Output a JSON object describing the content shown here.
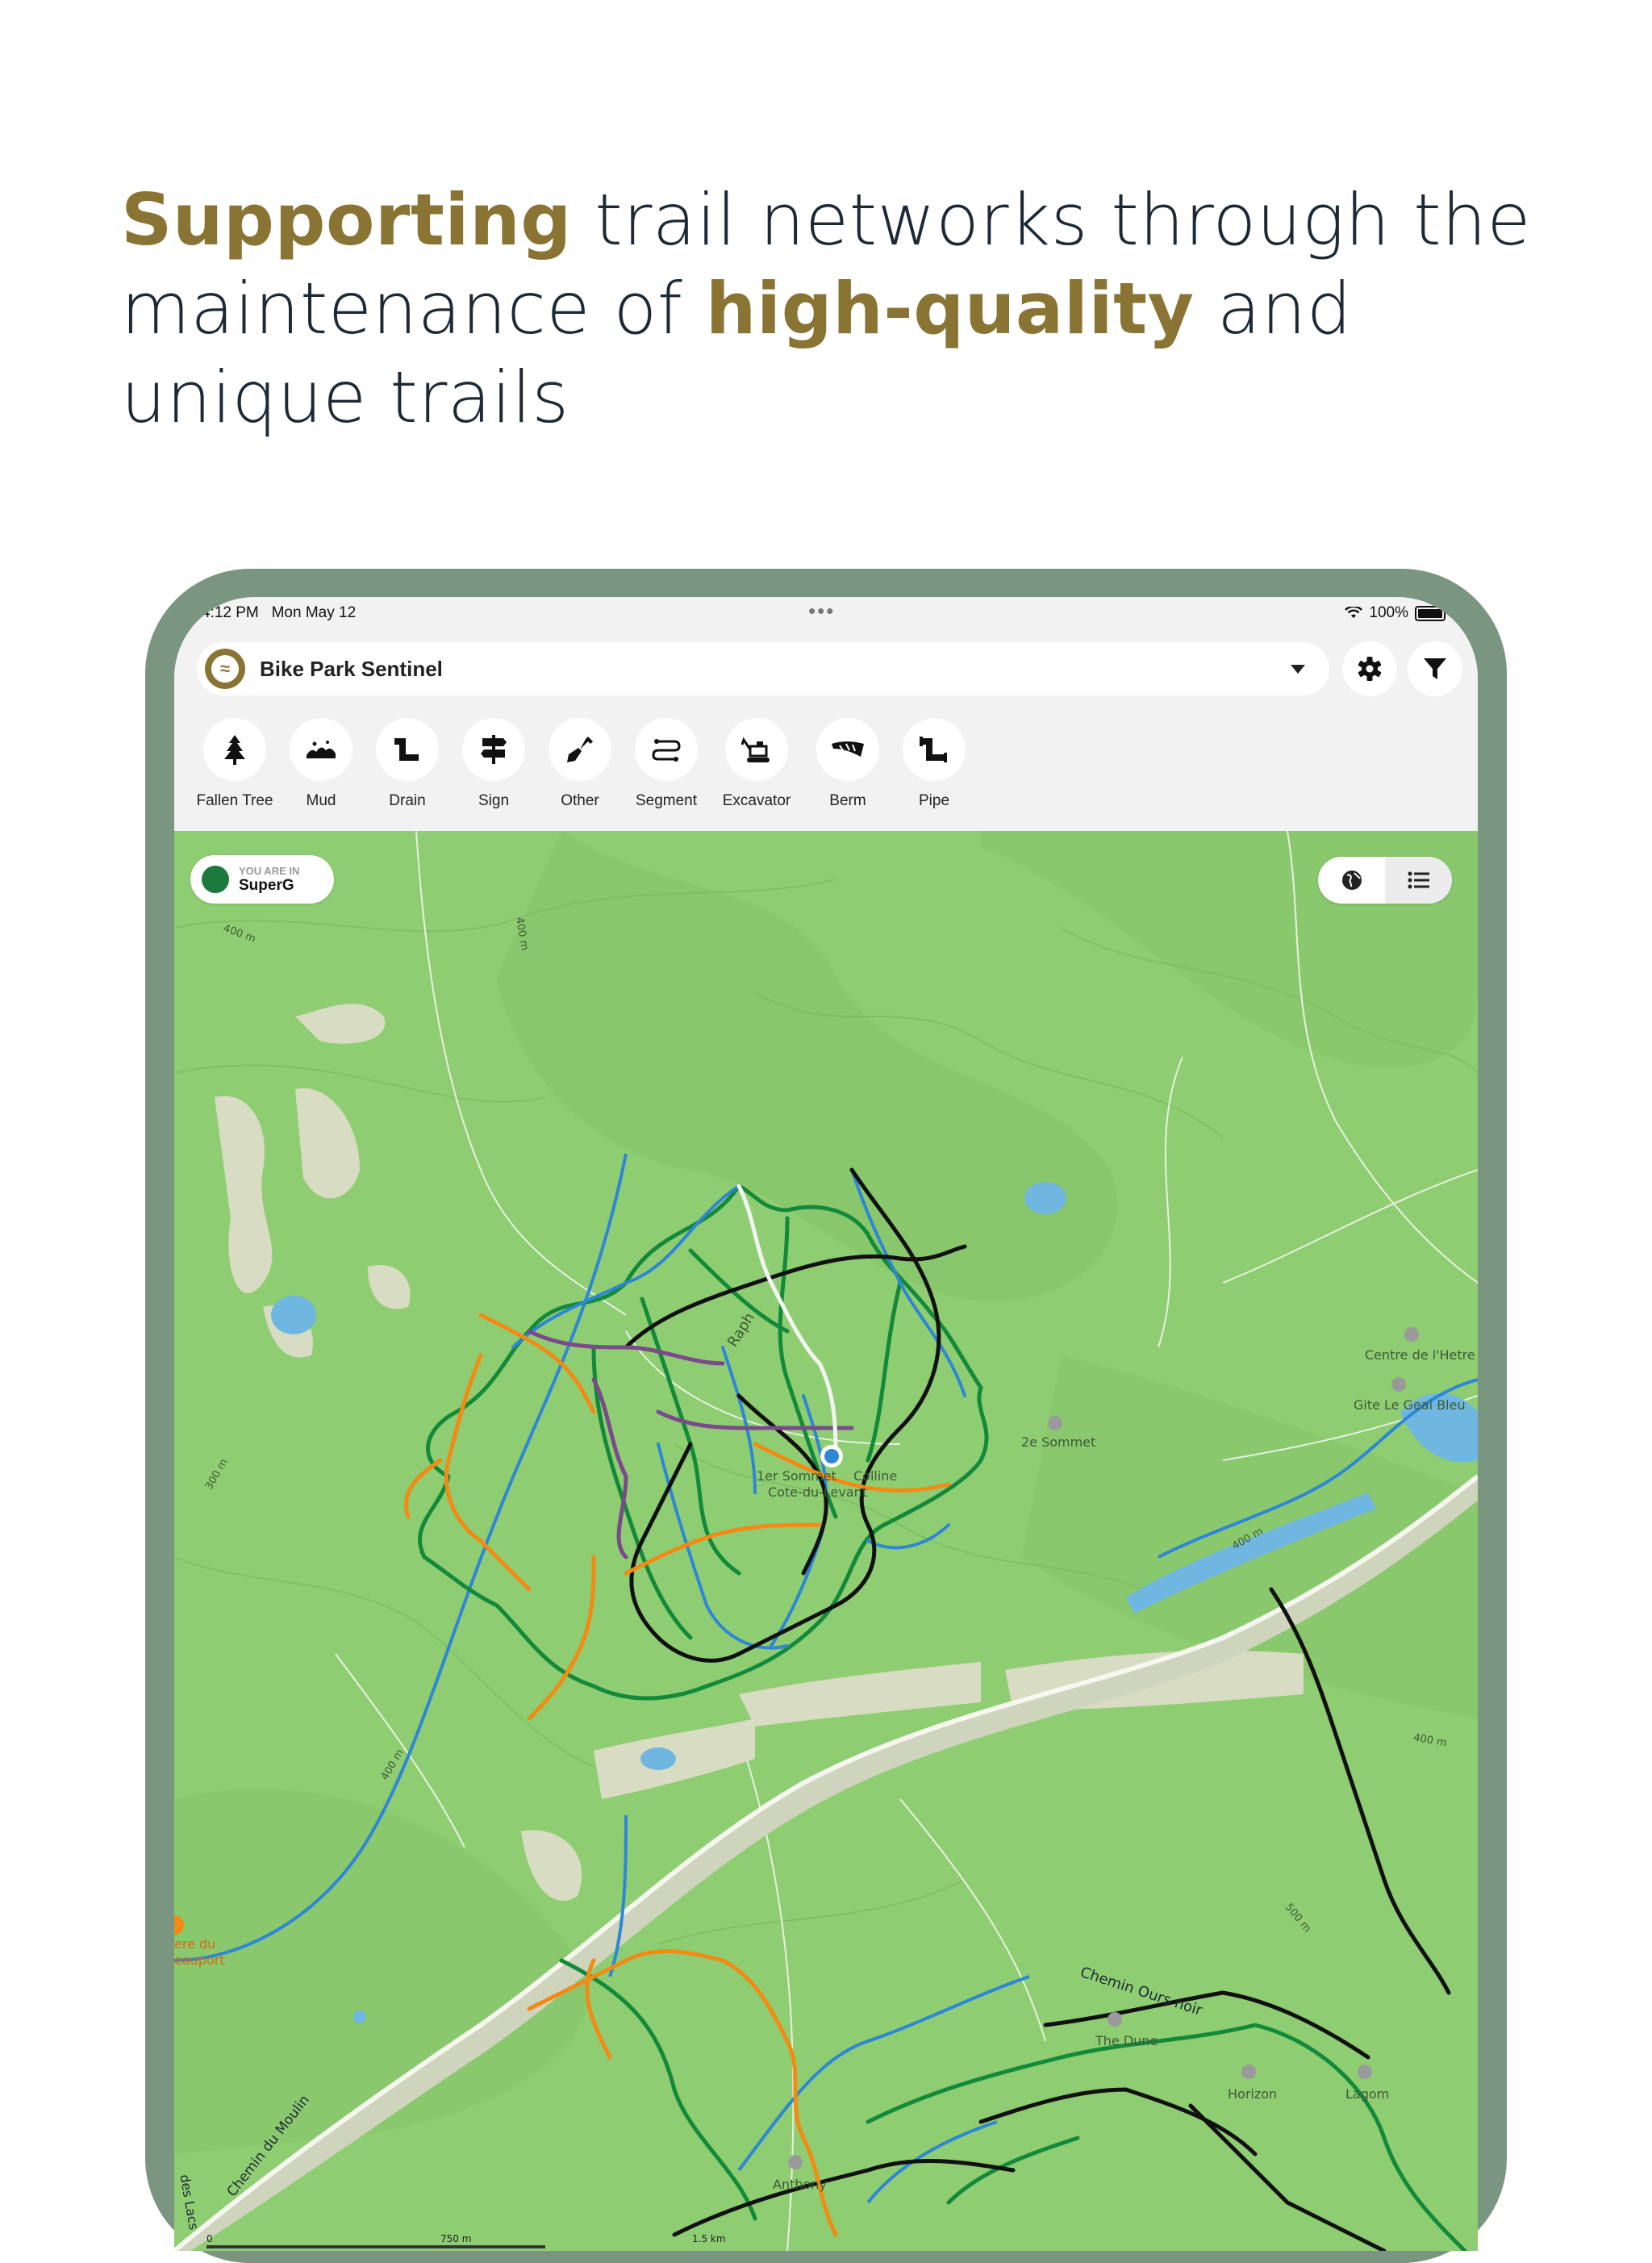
{
  "headline": {
    "part1": "Supporting",
    "part2": " trail networks through the maintenance of ",
    "part3": "high-quality",
    "part4": " and unique trails"
  },
  "status_bar": {
    "time": "4:12 PM",
    "date": "Mon May 12",
    "battery": "100%"
  },
  "header": {
    "app_name": "Bike Park Sentinel"
  },
  "tools": [
    {
      "label": "Fallen Tree",
      "icon": "fallen-tree-icon"
    },
    {
      "label": "Mud",
      "icon": "mud-icon"
    },
    {
      "label": "Drain",
      "icon": "drain-icon"
    },
    {
      "label": "Sign",
      "icon": "sign-icon"
    },
    {
      "label": "Other",
      "icon": "shovel-icon"
    },
    {
      "label": "Segment",
      "icon": "segment-icon"
    },
    {
      "label": "Excavator",
      "icon": "excavator-icon"
    },
    {
      "label": "Berm",
      "icon": "berm-icon"
    },
    {
      "label": "Pipe",
      "icon": "pipe-icon"
    }
  ],
  "location": {
    "subtitle": "YOU ARE IN",
    "name": "SuperG"
  },
  "map_labels": {
    "raph": "Raph",
    "summit": "1er Sommet",
    "colline": "Colline",
    "cote_du_levant": "Cote-du-Levant",
    "second_summit": "2e Sommet",
    "centre_hetre": "Centre de l'Hetre",
    "gite": "Gite Le Geai Bleu",
    "chemin_ours_noir": "Chemin Ours noir",
    "the_dune": "The Dune",
    "horizon": "Horizon",
    "lagom": "Lagom",
    "anthony": "Anthony",
    "chemin_du_moulin": "Chemin du Moulin",
    "beauport_1": "ere du",
    "beauport_2": "eauport",
    "lacs": "des Lacs",
    "elev_400a": "400 m",
    "elev_400b": "400 m",
    "elev_400c": "400 m",
    "elev_400d": "400 m",
    "elev_400e": "400 m",
    "elev_300": "300 m",
    "elev_500": "500 m",
    "scale_0": "0",
    "scale_750": "750 m",
    "scale_15": "1.5 km"
  },
  "colors": {
    "accent": "#8a7433",
    "map_green": "#8fcd72",
    "trail_green": "#13893a",
    "trail_black": "#111111",
    "trail_blue": "#2e86d6",
    "trail_orange": "#f28a14",
    "trail_purple": "#7a4a8a"
  }
}
